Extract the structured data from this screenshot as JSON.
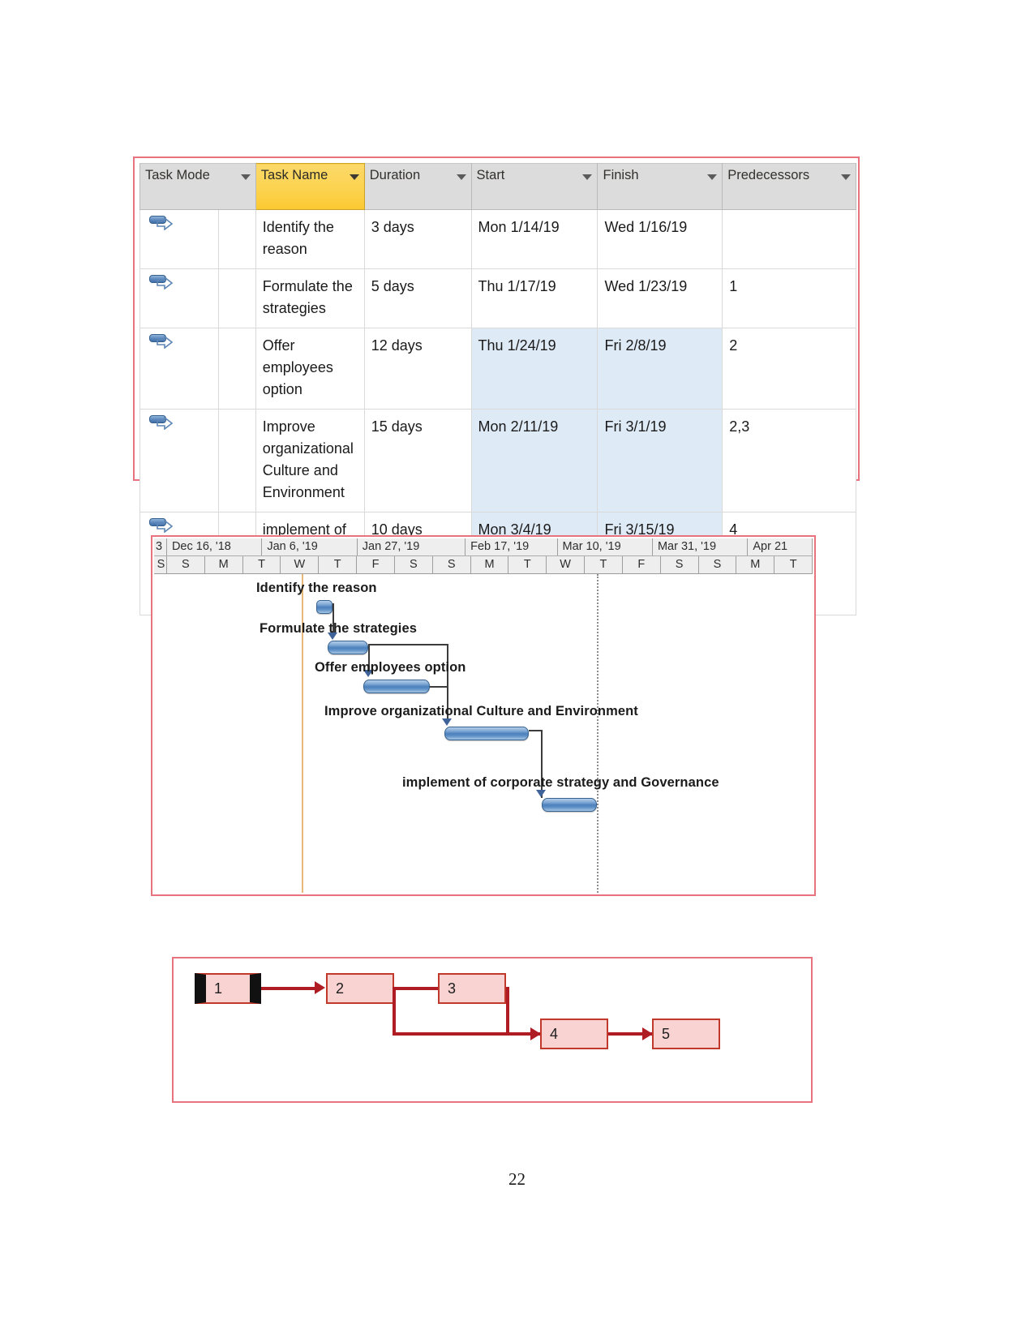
{
  "document": {
    "page_number": "22"
  },
  "task_table": {
    "columns": [
      {
        "key": "task_mode",
        "label": "Task Mode",
        "has_filter": true,
        "highlighted": false
      },
      {
        "key": "task_name",
        "label": "Task Name",
        "has_filter": true,
        "highlighted": true
      },
      {
        "key": "duration",
        "label": "Duration",
        "has_filter": true,
        "highlighted": false
      },
      {
        "key": "start",
        "label": "Start",
        "has_filter": true,
        "highlighted": false
      },
      {
        "key": "finish",
        "label": "Finish",
        "has_filter": true,
        "highlighted": false
      },
      {
        "key": "predecessors",
        "label": "Predecessors",
        "has_filter": true,
        "highlighted": false
      }
    ],
    "rows": [
      {
        "id": 1,
        "mode_icon": "auto-schedule-icon",
        "task_name": "Identify the reason",
        "duration": "3 days",
        "start": "Mon 1/14/19",
        "finish": "Wed 1/16/19",
        "predecessors": ""
      },
      {
        "id": 2,
        "mode_icon": "auto-schedule-icon",
        "task_name": "Formulate the strategies",
        "duration": "5 days",
        "start": "Thu 1/17/19",
        "finish": "Wed 1/23/19",
        "predecessors": "1"
      },
      {
        "id": 3,
        "mode_icon": "auto-schedule-icon",
        "task_name": "Offer employees option",
        "duration": "12 days",
        "start": "Thu 1/24/19",
        "finish": "Fri 2/8/19",
        "predecessors": "2"
      },
      {
        "id": 4,
        "mode_icon": "auto-schedule-icon",
        "task_name": "Improve organizational Culture and Environment",
        "duration": "15 days",
        "start": "Mon 2/11/19",
        "finish": "Fri 3/1/19",
        "predecessors": "2,3"
      },
      {
        "id": 5,
        "mode_icon": "auto-schedule-icon",
        "task_name": "implement of corporate strategy and Governance",
        "duration": "10 days",
        "start": "Mon 3/4/19",
        "finish": "Fri 3/15/19",
        "predecessors": "4"
      }
    ]
  },
  "gantt": {
    "timeline_months": [
      "3",
      "Dec 16, '18",
      "Jan 6, '19",
      "Jan 27, '19",
      "Feb 17, '19",
      "Mar 10, '19",
      "Mar 31, '19",
      "Apr 21"
    ],
    "timeline_days": [
      "S",
      "S",
      "M",
      "T",
      "W",
      "T",
      "F",
      "S",
      "S",
      "M",
      "T",
      "W",
      "T",
      "F",
      "S",
      "S",
      "M",
      "T"
    ],
    "bars": [
      {
        "label": "Identify the reason",
        "duration": "3 days"
      },
      {
        "label": "Formulate the strategies",
        "duration": "5 days"
      },
      {
        "label": "Offer employees option",
        "duration": "12 days"
      },
      {
        "label": "Improve organizational Culture and Environment",
        "duration": "15 days"
      },
      {
        "label": "implement of corporate strategy and Governance",
        "duration": "10 days"
      }
    ],
    "colors": {
      "bar_fill": "#4b81bd",
      "bar_border": "#36618f",
      "today_line": "#e8b87a",
      "status_line": "#8c8c8c",
      "frame_border": "#e8737f"
    }
  },
  "network_diagram": {
    "nodes": [
      {
        "id": "1",
        "label": "1",
        "critical": true
      },
      {
        "id": "2",
        "label": "2",
        "critical": false
      },
      {
        "id": "3",
        "label": "3",
        "critical": false
      },
      {
        "id": "4",
        "label": "4",
        "critical": false
      },
      {
        "id": "5",
        "label": "5",
        "critical": false
      }
    ],
    "edges": [
      {
        "from": "1",
        "to": "2"
      },
      {
        "from": "2",
        "to": "3"
      },
      {
        "from": "2",
        "to": "4"
      },
      {
        "from": "3",
        "to": "4"
      },
      {
        "from": "4",
        "to": "5"
      }
    ],
    "colors": {
      "node_fill": "#f9d2d2",
      "node_border": "#c0392b",
      "edge": "#b01c23",
      "critical_marker": "#111111"
    }
  }
}
